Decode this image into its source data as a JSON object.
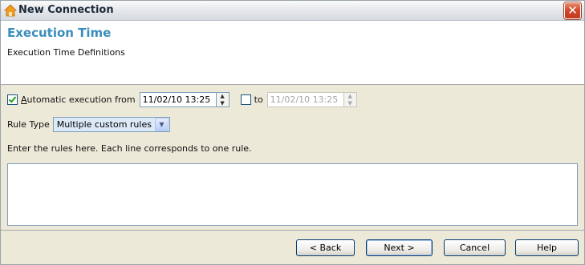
{
  "window": {
    "title": "New Connection",
    "close_glyph": "✕",
    "app_icon": "house-icon"
  },
  "header": {
    "title": "Execution Time",
    "subtitle": "Execution Time Definitions"
  },
  "execution": {
    "auto_checked": true,
    "auto_label": "Automatic execution from",
    "from_value": "11/02/10 13:25",
    "to_checked": false,
    "to_label": "to",
    "to_value": "11/02/10 13:25"
  },
  "rule_type": {
    "label": "Rule Type",
    "selected": "Multiple custom rules"
  },
  "rules": {
    "instructions": "Enter the rules here. Each line corresponds to one rule.",
    "value": ""
  },
  "buttons": {
    "back": "< Back",
    "next": "Next >",
    "cancel": "Cancel",
    "help": "Help"
  },
  "colors": {
    "accent_title": "#3b8dbd",
    "close_button": "#d0462a",
    "panel_bg": "#ece9d8"
  }
}
